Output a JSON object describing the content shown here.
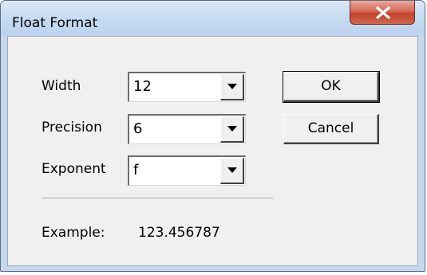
{
  "window": {
    "title": "Float Format"
  },
  "fields": {
    "width": {
      "label": "Width",
      "value": "12"
    },
    "precision": {
      "label": "Precision",
      "value": "6"
    },
    "exponent": {
      "label": "Exponent",
      "value": "f"
    }
  },
  "buttons": {
    "ok_label": "OK",
    "cancel_label": "Cancel"
  },
  "example": {
    "label": "Example:",
    "value": "123.456787"
  },
  "colors": {
    "close_button": "#c2412d",
    "dialog_face": "#f0f0f0",
    "frame": "#c5d8ee"
  },
  "icons": {
    "close": "close-icon",
    "dropdown": "chevron-down-icon"
  }
}
